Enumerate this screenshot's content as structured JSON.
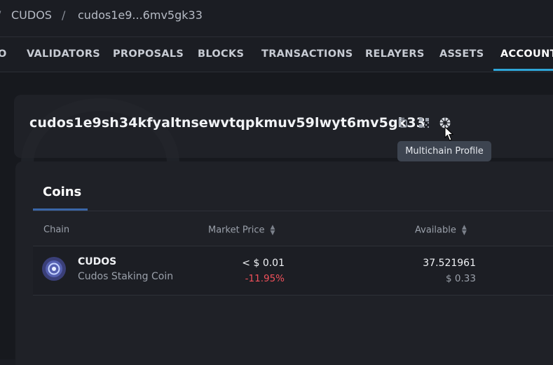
{
  "breadcrumb": {
    "separator": "/",
    "root": "CUDOS",
    "account_short": "cudos1e9...6mv5gk33"
  },
  "nav": {
    "partial_left": "O",
    "items": [
      "VALIDATORS",
      "PROPOSALS",
      "BLOCKS",
      "TRANSACTIONS",
      "RELAYERS",
      "ASSETS",
      "ACCOUNT"
    ],
    "active": "ACCOUNT"
  },
  "account": {
    "address": "cudos1e9sh34kfyaltnsewvtqpkmuv59lwyt6mv5gk33",
    "icons": [
      "copy-icon",
      "qr-code-icon",
      "multichain-profile-icon"
    ],
    "tooltip": "Multichain Profile"
  },
  "coins": {
    "tab_label": "Coins",
    "columns": {
      "chain": "Chain",
      "market_price": "Market Price",
      "available": "Available"
    },
    "rows": [
      {
        "symbol": "CUDOS",
        "name": "Cudos Staking Coin",
        "price": "< $ 0.01",
        "change": "-11.95%",
        "available": "37.521961",
        "available_usd": "$ 0.33"
      }
    ]
  },
  "colors": {
    "accent": "#2fa6d8",
    "negative": "#f0505a"
  }
}
